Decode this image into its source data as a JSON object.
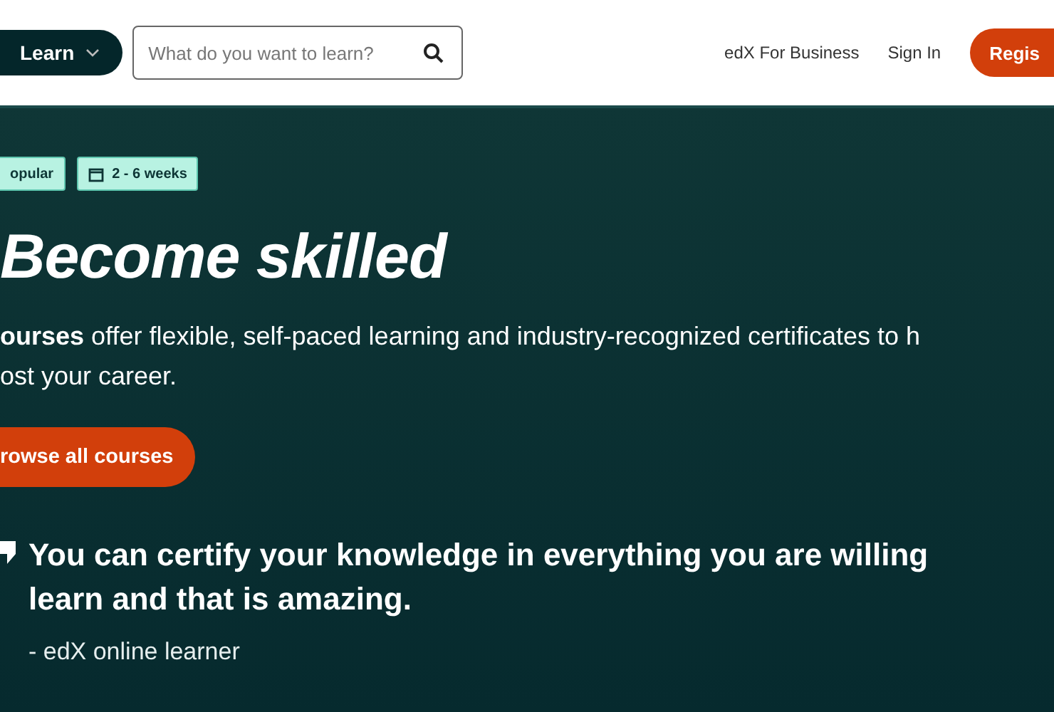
{
  "header": {
    "learn_menu": {
      "label": "Learn",
      "expanded": false
    },
    "search": {
      "placeholder": "What do you want to learn?"
    },
    "links": [
      "edX For Business",
      "Sign In"
    ],
    "register_button": "Regis"
  },
  "hero": {
    "badges": [
      {
        "kind": "plain",
        "label": "opular"
      },
      {
        "kind": "calendar",
        "label": "2 - 6 weeks"
      }
    ],
    "title": "Become skilled",
    "description_lines": [
      "**ourses** offer flexible, self-paced learning and industry-recognized certificates to h",
      "ost your career."
    ],
    "cta_button": "rowse all courses",
    "quote": {
      "lines": [
        "You can certify your knowledge in everything you are willing",
        "learn and that is amazing."
      ],
      "attribution": "- edX online learner"
    }
  }
}
